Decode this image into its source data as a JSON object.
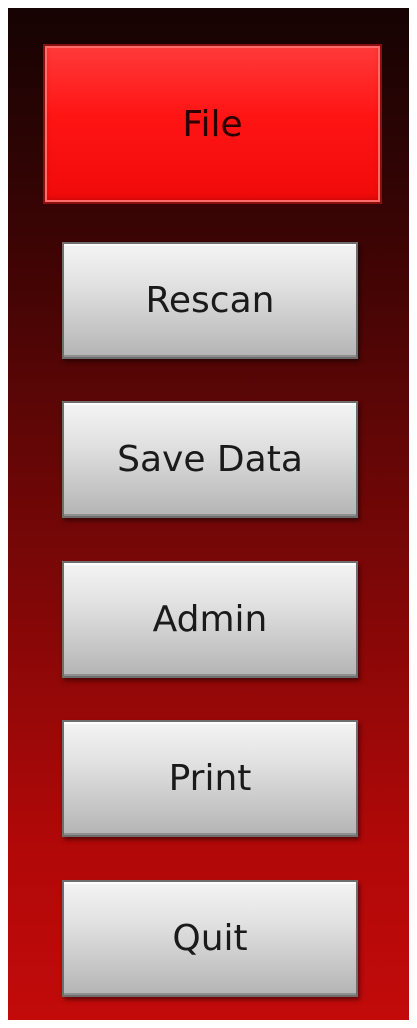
{
  "menu": {
    "file_label": "File",
    "rescan_label": "Rescan",
    "save_data_label": "Save Data",
    "admin_label": "Admin",
    "print_label": "Print",
    "quit_label": "Quit"
  },
  "colors": {
    "file_button": "#ff1414",
    "panel_top": "#160303",
    "panel_bottom": "#c20a0a",
    "grey_button": "#d6d6d6"
  }
}
